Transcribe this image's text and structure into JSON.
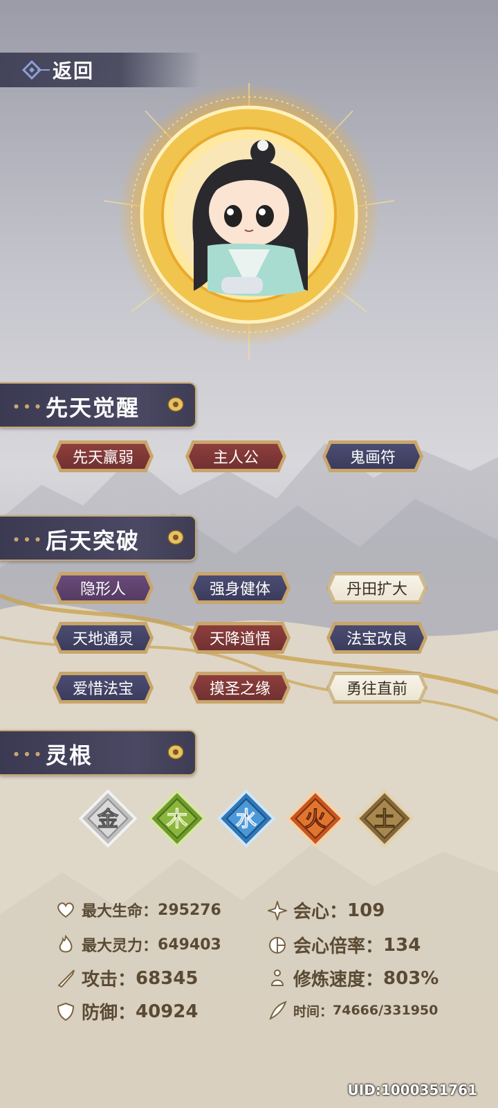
{
  "nav": {
    "back_label": "返回",
    "back_icon": "diamond-arrow-icon"
  },
  "innate": {
    "title": "先天觉醒",
    "tags": [
      {
        "label": "先天羸弱",
        "style": "red"
      },
      {
        "label": "主人公",
        "style": "red"
      },
      {
        "label": "鬼画符",
        "style": "navy"
      }
    ]
  },
  "acquired": {
    "title": "后天突破",
    "tags": [
      {
        "label": "隐形人",
        "style": "purple"
      },
      {
        "label": "强身健体",
        "style": "navy"
      },
      {
        "label": "丹田扩大",
        "style": "white"
      },
      {
        "label": "天地通灵",
        "style": "navy"
      },
      {
        "label": "天降道悟",
        "style": "red"
      },
      {
        "label": "法宝改良",
        "style": "navy"
      },
      {
        "label": "爱惜法宝",
        "style": "navy"
      },
      {
        "label": "摸圣之缘",
        "style": "red"
      },
      {
        "label": "勇往直前",
        "style": "white"
      }
    ]
  },
  "roots": {
    "title": "灵根",
    "elements": [
      {
        "char": "金",
        "color": "#bfbfbf"
      },
      {
        "char": "木",
        "color": "#7ea23a"
      },
      {
        "char": "水",
        "color": "#3a86c4"
      },
      {
        "char": "火",
        "color": "#d66a2a"
      },
      {
        "char": "土",
        "color": "#9a7a45"
      }
    ]
  },
  "stats": {
    "hp": {
      "label": "最大生命：",
      "value": "295276"
    },
    "crit": {
      "label": "会心：",
      "value": "109"
    },
    "mp": {
      "label": "最大灵力：",
      "value": "649403"
    },
    "crit_rate": {
      "label": "会心倍率：",
      "value": "134"
    },
    "atk": {
      "label": "攻击：",
      "value": "68345"
    },
    "cult_speed": {
      "label": "修炼速度：",
      "value": "803%"
    },
    "def": {
      "label": "防御：",
      "value": "40924"
    },
    "time": {
      "label": "时间：",
      "value": "74666/331950"
    }
  },
  "uid": "UID:1000351761",
  "colors": {
    "gold": "#c8a770",
    "header_bg": "#3b3a52",
    "stat_text": "#5a4a33"
  }
}
